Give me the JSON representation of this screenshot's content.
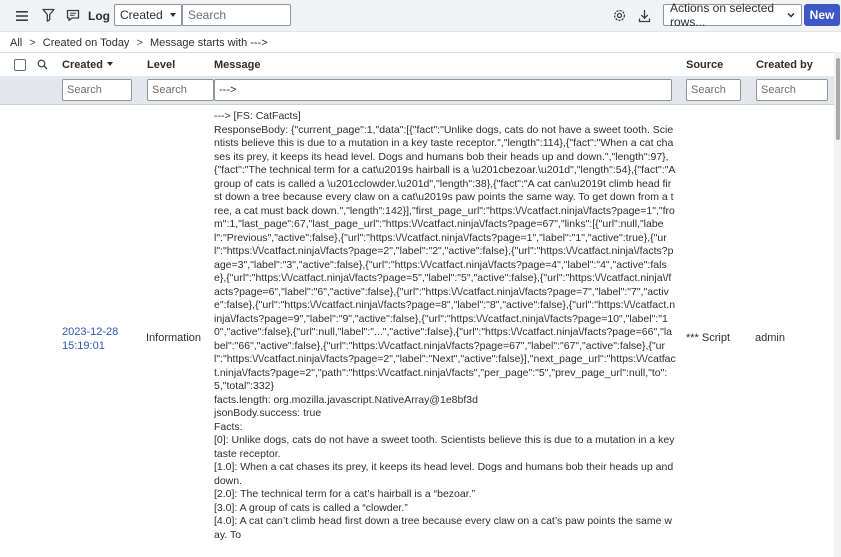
{
  "toolbar": {
    "title": "Log",
    "field_select": "Created",
    "search_placeholder": "Search",
    "actions_label": "Actions on selected rows...",
    "new_label": "New"
  },
  "breadcrumb": {
    "items": [
      "All",
      "Created on Today",
      "Message starts with --->"
    ],
    "separator": ">"
  },
  "table": {
    "columns": {
      "created": "Created",
      "level": "Level",
      "message": "Message",
      "source": "Source",
      "created_by": "Created by"
    },
    "filters": {
      "created": "Search",
      "level": "Search",
      "message": "--->",
      "source": "Search",
      "created_by": "Search"
    },
    "row": {
      "created": "2023-12-28 15:19:01",
      "level": "Information",
      "message": "---> [FS: CatFacts]\nResponseBody: {\"current_page\":1,\"data\":[{\"fact\":\"Unlike dogs, cats do not have a sweet tooth. Scientists believe this is due to a mutation in a key taste receptor.\",\"length\":114},{\"fact\":\"When a cat chases its prey, it keeps its head level. Dogs and humans bob their heads up and down.\",\"length\":97},{\"fact\":\"The technical term for a cat\\u2019s hairball is a \\u201cbezoar.\\u201d\",\"length\":54},{\"fact\":\"A group of cats is called a \\u201cclowder.\\u201d\",\"length\":38},{\"fact\":\"A cat can\\u2019t climb head first down a tree because every claw on a cat\\u2019s paw points the same way. To get down from a tree, a cat must back down.\",\"length\":142}],\"first_page_url\":\"https:\\/\\/catfact.ninja\\/facts?page=1\",\"from\":1,\"last_page\":67,\"last_page_url\":\"https:\\/\\/catfact.ninja\\/facts?page=67\",\"links\":[{\"url\":null,\"label\":\"Previous\",\"active\":false},{\"url\":\"https:\\/\\/catfact.ninja\\/facts?page=1\",\"label\":\"1\",\"active\":true},{\"url\":\"https:\\/\\/catfact.ninja\\/facts?page=2\",\"label\":\"2\",\"active\":false},{\"url\":\"https:\\/\\/catfact.ninja\\/facts?page=3\",\"label\":\"3\",\"active\":false},{\"url\":\"https:\\/\\/catfact.ninja\\/facts?page=4\",\"label\":\"4\",\"active\":false},{\"url\":\"https:\\/\\/catfact.ninja\\/facts?page=5\",\"label\":\"5\",\"active\":false},{\"url\":\"https:\\/\\/catfact.ninja\\/facts?page=6\",\"label\":\"6\",\"active\":false},{\"url\":\"https:\\/\\/catfact.ninja\\/facts?page=7\",\"label\":\"7\",\"active\":false},{\"url\":\"https:\\/\\/catfact.ninja\\/facts?page=8\",\"label\":\"8\",\"active\":false},{\"url\":\"https:\\/\\/catfact.ninja\\/facts?page=9\",\"label\":\"9\",\"active\":false},{\"url\":\"https:\\/\\/catfact.ninja\\/facts?page=10\",\"label\":\"10\",\"active\":false},{\"url\":null,\"label\":\"...\",\"active\":false},{\"url\":\"https:\\/\\/catfact.ninja\\/facts?page=66\",\"label\":\"66\",\"active\":false},{\"url\":\"https:\\/\\/catfact.ninja\\/facts?page=67\",\"label\":\"67\",\"active\":false},{\"url\":\"https:\\/\\/catfact.ninja\\/facts?page=2\",\"label\":\"Next\",\"active\":false}],\"next_page_url\":\"https:\\/\\/catfact.ninja\\/facts?page=2\",\"path\":\"https:\\/\\/catfact.ninja\\/facts\",\"per_page\":\"5\",\"prev_page_url\":null,\"to\":5,\"total\":332}\nfacts.length: org.mozilla.javascript.NativeArray@1e8bf3d\njsonBody.success: true\nFacts:\n[0]: Unlike dogs, cats do not have a sweet tooth. Scientists believe this is due to a mutation in a key taste receptor.\n[1.0]: When a cat chases its prey, it keeps its head level. Dogs and humans bob their heads up and down.\n[2.0]: The technical term for a cat’s hairball is a “bezoar.”\n[3.0]: A group of cats is called a “clowder.”\n[4.0]: A cat can’t climb head first down a tree because every claw on a cat’s paw points the same way. To",
      "source": "*** Script",
      "created_by": "admin"
    }
  },
  "icons": {
    "menu": "hamburger-menu-icon",
    "filter": "funnel-filter-icon",
    "chat": "chat-bubble-icon",
    "settings": "gear-icon",
    "export": "download-icon",
    "column_search": "search-icon",
    "actions_chevron": "chevron-down-icon"
  },
  "colors": {
    "primary": "#3d57c6",
    "link": "#2b58b8",
    "toolbar_bg": "#f1f2f3",
    "filter_bg": "#e3e6ea"
  }
}
